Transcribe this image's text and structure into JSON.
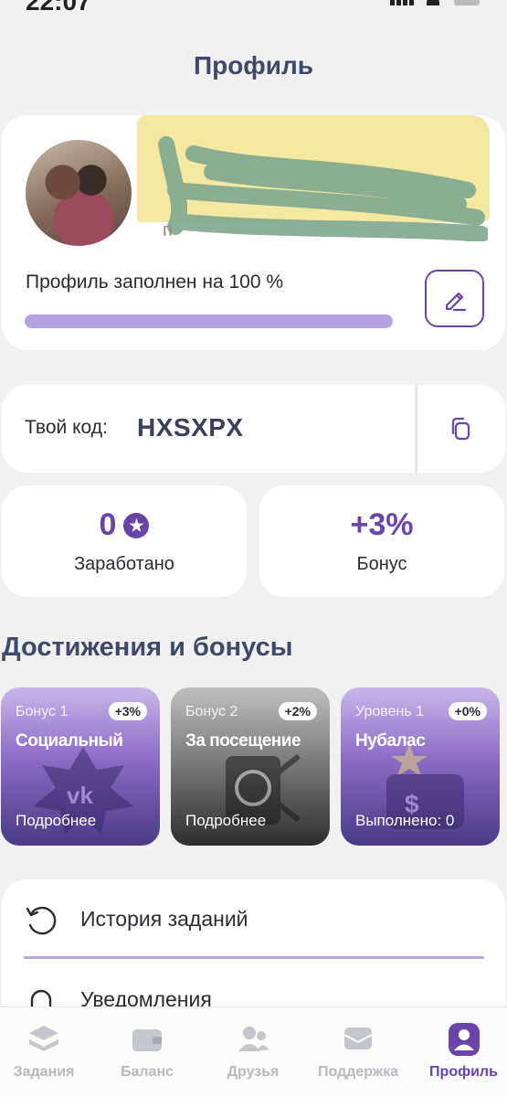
{
  "status_bar": {
    "time": "22:07"
  },
  "page": {
    "title": "Профиль"
  },
  "profile": {
    "name_partial": "п",
    "fill_label": "Профиль заполнен на 100 %",
    "fill_percent": 100,
    "edit_icon": "pencil-icon"
  },
  "referral": {
    "label": "Твой код:",
    "code": "HXSXPX",
    "copy_icon": "copy-icon"
  },
  "stats": {
    "earned_value": "0",
    "earned_label": "Заработано",
    "bonus_value": "+3%",
    "bonus_label": "Бонус"
  },
  "achievements": {
    "title": "Достижения и бонусы",
    "cards": [
      {
        "caption": "Бонус 1",
        "percent": "+3%",
        "title": "Социальный",
        "footer": "Подробнее"
      },
      {
        "caption": "Бонус 2",
        "percent": "+2%",
        "title": "За посещение",
        "footer": "Подробнее"
      },
      {
        "caption": "Уровень 1",
        "percent": "+0%",
        "title": "Нубалас",
        "footer": "Выполнено: 0"
      }
    ]
  },
  "menu": {
    "items": [
      {
        "label": "История заданий",
        "icon": "history-icon"
      },
      {
        "label": "Уведомления",
        "icon": "bell-icon"
      }
    ]
  },
  "tabbar": {
    "items": [
      {
        "label": "Задания",
        "icon": "tasks-icon"
      },
      {
        "label": "Баланс",
        "icon": "wallet-icon"
      },
      {
        "label": "Друзья",
        "icon": "friends-icon"
      },
      {
        "label": "Поддержка",
        "icon": "support-icon"
      },
      {
        "label": "Профиль",
        "icon": "profile-icon"
      }
    ],
    "active_index": 4
  },
  "colors": {
    "accent": "#6a44a8",
    "title": "#3f4a6b",
    "progress": "#b4a2e3"
  }
}
